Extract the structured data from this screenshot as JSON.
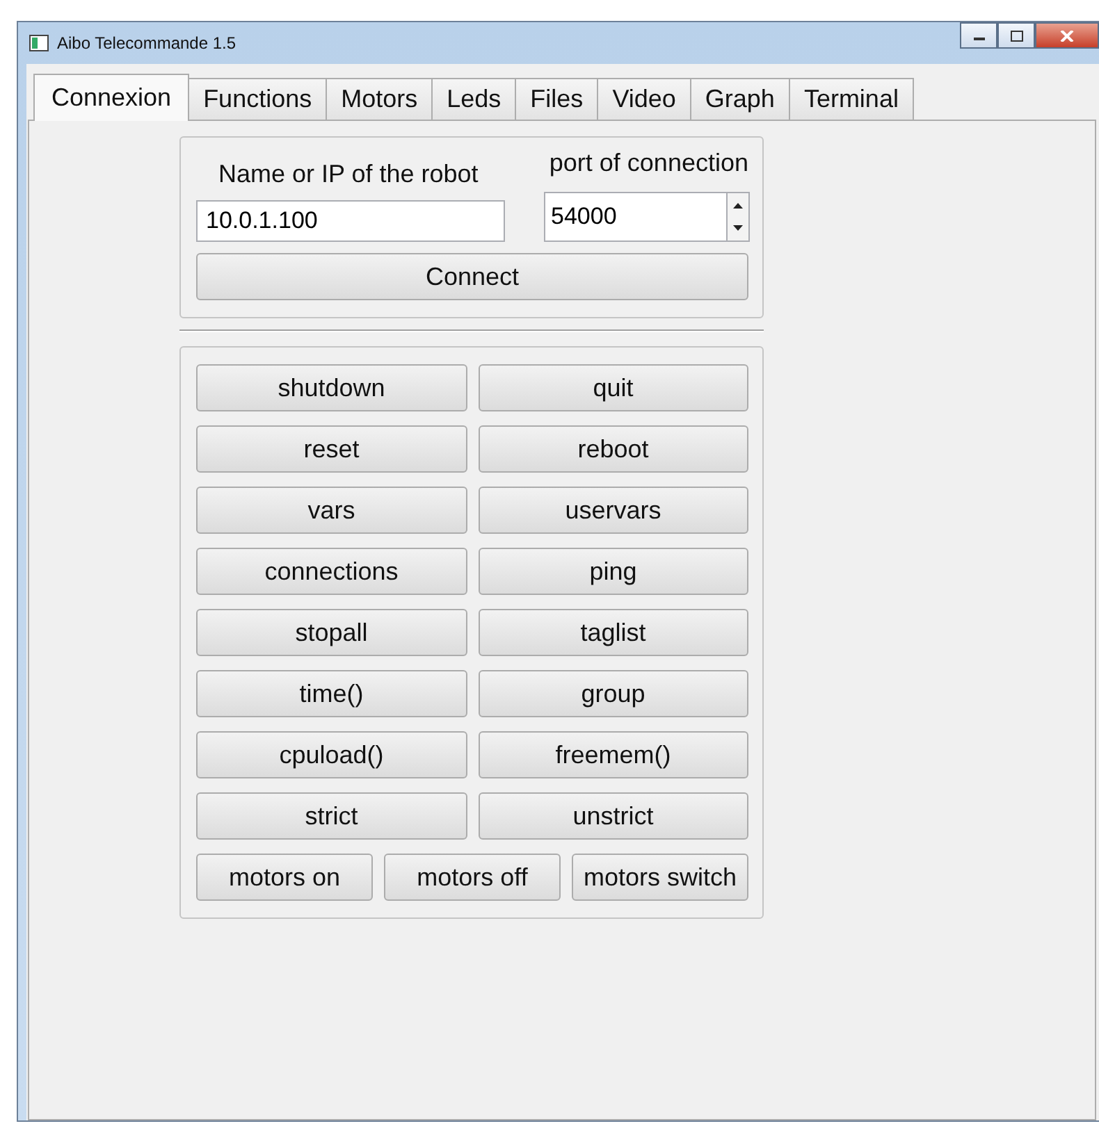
{
  "window": {
    "title": "Aibo Telecommande 1.5"
  },
  "tabs": [
    {
      "label": "Connexion",
      "selected": true
    },
    {
      "label": "Functions",
      "selected": false
    },
    {
      "label": "Motors",
      "selected": false
    },
    {
      "label": "Leds",
      "selected": false
    },
    {
      "label": "Files",
      "selected": false
    },
    {
      "label": "Video",
      "selected": false
    },
    {
      "label": "Graph",
      "selected": false
    },
    {
      "label": "Terminal",
      "selected": false
    }
  ],
  "connection": {
    "host_label": "Name or IP of the robot",
    "host_value": "10.0.1.100",
    "port_label": "port of connection",
    "port_value": "54000",
    "connect_button": "Connect"
  },
  "command_rows": [
    [
      "shutdown",
      "quit"
    ],
    [
      "reset",
      "reboot"
    ],
    [
      "vars",
      "uservars"
    ],
    [
      "connections",
      "ping"
    ],
    [
      "stopall",
      "taglist"
    ],
    [
      "time()",
      "group"
    ],
    [
      "cpuload()",
      "freemem()"
    ],
    [
      "strict",
      "unstrict"
    ],
    [
      "motors on",
      "motors off",
      "motors switch"
    ]
  ]
}
